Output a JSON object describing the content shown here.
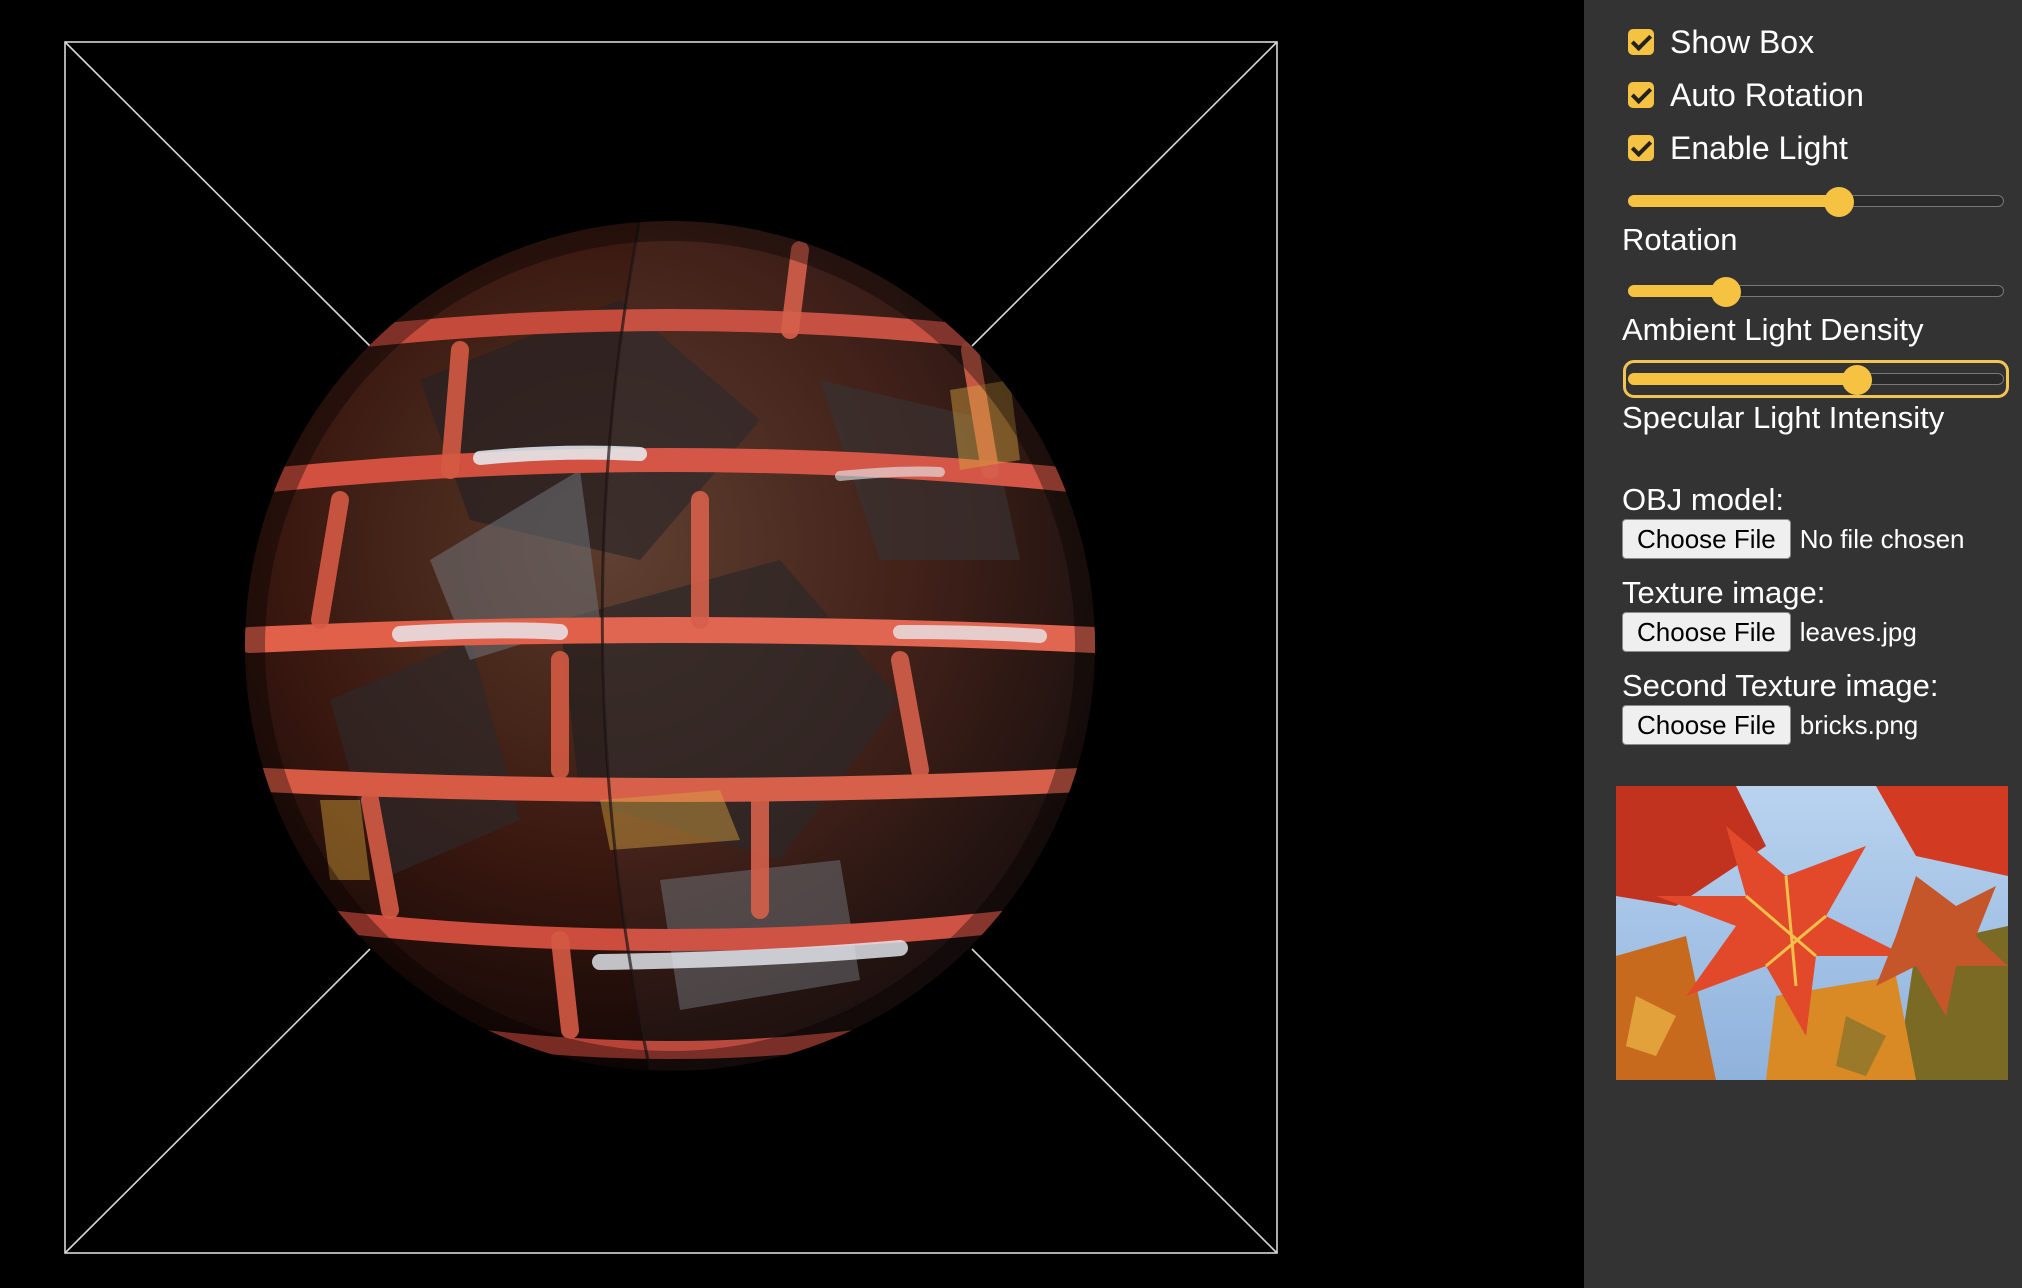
{
  "controls": {
    "show_box": {
      "label": "Show Box",
      "checked": true
    },
    "auto_rotation": {
      "label": "Auto Rotation",
      "checked": true
    },
    "enable_light": {
      "label": "Enable Light",
      "checked": true
    }
  },
  "sliders": [
    {
      "label": "Rotation",
      "value": 0.56
    },
    {
      "label": "Ambient Light Density",
      "value": 0.26
    },
    {
      "label": "Specular Light Intensity",
      "value": 0.61
    }
  ],
  "files": {
    "obj_model": {
      "label": "OBJ model:",
      "button": "Choose File",
      "filename": "No file chosen"
    },
    "texture": {
      "label": "Texture image:",
      "button": "Choose File",
      "filename": "leaves.jpg"
    },
    "second_texture": {
      "label": "Second Texture image:",
      "button": "Choose File",
      "filename": "bricks.png"
    }
  },
  "colors": {
    "accent": "#f5c242",
    "panel_bg": "#333333",
    "viewport_bg": "#000000"
  }
}
